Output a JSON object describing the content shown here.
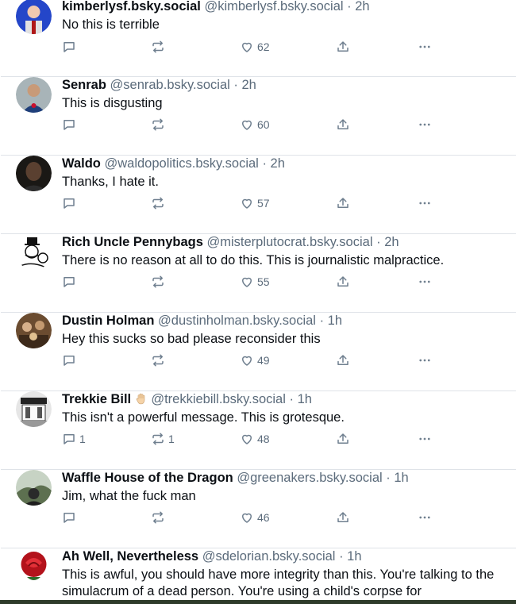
{
  "posts": [
    {
      "name": "kimberlysf.bsky.social",
      "handle": "@kimberlysf.bsky.social",
      "time": "2h",
      "text": "No this is terrible",
      "replies": "",
      "reposts": "",
      "likes": "62",
      "avatar_color": "#2446c9"
    },
    {
      "name": "Senrab",
      "handle": "@senrab.bsky.social",
      "time": "2h",
      "text": "This is disgusting",
      "replies": "",
      "reposts": "",
      "likes": "60",
      "avatar_color": "#8a9aa0"
    },
    {
      "name": "Waldo",
      "handle": "@waldopolitics.bsky.social",
      "time": "2h",
      "text": "Thanks, I hate it.",
      "replies": "",
      "reposts": "",
      "likes": "57",
      "avatar_color": "#3a3530"
    },
    {
      "name": "Rich Uncle Pennybags",
      "handle": "@misterplutocrat.bsky.social",
      "time": "2h",
      "text": "There is no reason at all to do this. This is journalistic malpractice.",
      "replies": "",
      "reposts": "",
      "likes": "55",
      "avatar_color": "#ffffff"
    },
    {
      "name": "Dustin Holman",
      "handle": "@dustinholman.bsky.social",
      "time": "1h",
      "text": "Hey this sucks so bad please reconsider this",
      "replies": "",
      "reposts": "",
      "likes": "49",
      "avatar_color": "#7a5a3a"
    },
    {
      "name": "Trekkie Bill",
      "handle": "@trekkiebill.bsky.social",
      "time": "1h",
      "text": "This isn't a powerful message. This is grotesque.",
      "replies": "1",
      "reposts": "1",
      "likes": "48",
      "avatar_color": "#d8d8d8"
    },
    {
      "name": "Waffle House of the Dragon",
      "handle": "@greenakers.bsky.social",
      "time": "1h",
      "text": "Jim, what the fuck man",
      "replies": "",
      "reposts": "",
      "likes": "46",
      "avatar_color": "#7c8a70"
    },
    {
      "name": "Ah Well, Nevertheless",
      "handle": "@sdelorian.bsky.social",
      "time": "1h",
      "text": "This is awful, you should have more integrity than this. You're talking to the simulacrum of a dead person. You're using a child's corpse for",
      "replies": "",
      "reposts": "",
      "likes": "",
      "avatar_color": "#b3121b"
    }
  ],
  "separator": "·",
  "icons": {
    "reply": "reply-icon",
    "repost": "repost-icon",
    "like": "heart-icon",
    "share": "share-icon",
    "more": "more-icon"
  }
}
